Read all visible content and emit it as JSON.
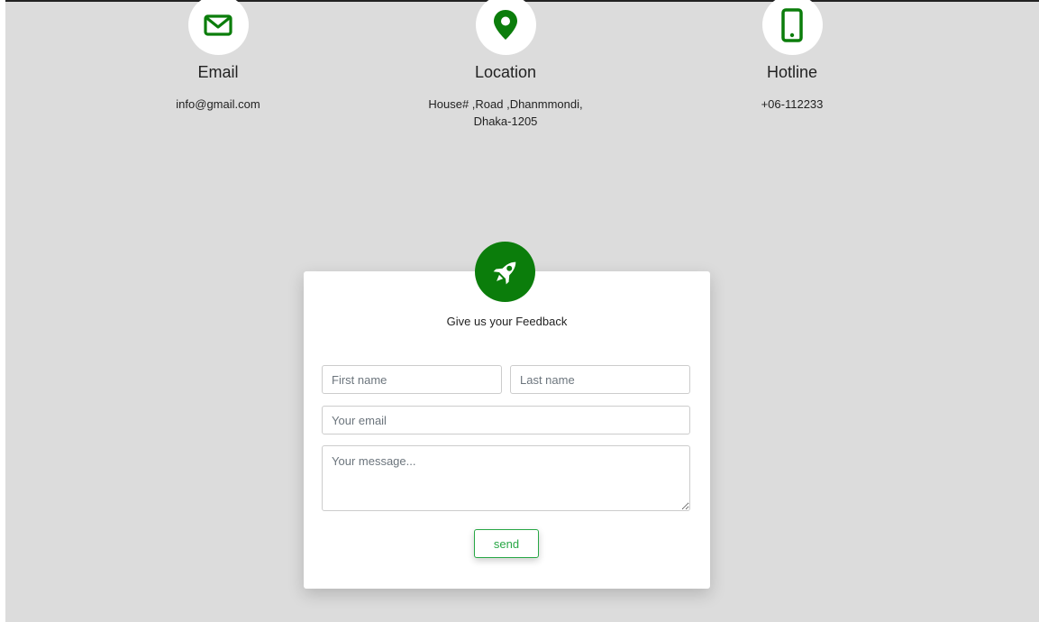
{
  "colors": {
    "background": "#dcdcdc",
    "accent_green": "#0b7d0b",
    "button_green": "#28a745",
    "card": "#ffffff"
  },
  "contact": {
    "email": {
      "icon": "envelope-icon",
      "title": "Email",
      "text": "info@gmail.com"
    },
    "location": {
      "icon": "map-pin-icon",
      "title": "Location",
      "line1": "House# ,Road ,Dhanmmondi,",
      "line2": "Dhaka-1205"
    },
    "hotline": {
      "icon": "mobile-phone-icon",
      "title": "Hotline",
      "text": "+06-112233"
    }
  },
  "feedback": {
    "icon": "rocket-icon",
    "title": "Give us your Feedback",
    "first_name_placeholder": "First name",
    "last_name_placeholder": "Last name",
    "email_placeholder": "Your email",
    "message_placeholder": "Your message...",
    "send_label": "send"
  }
}
